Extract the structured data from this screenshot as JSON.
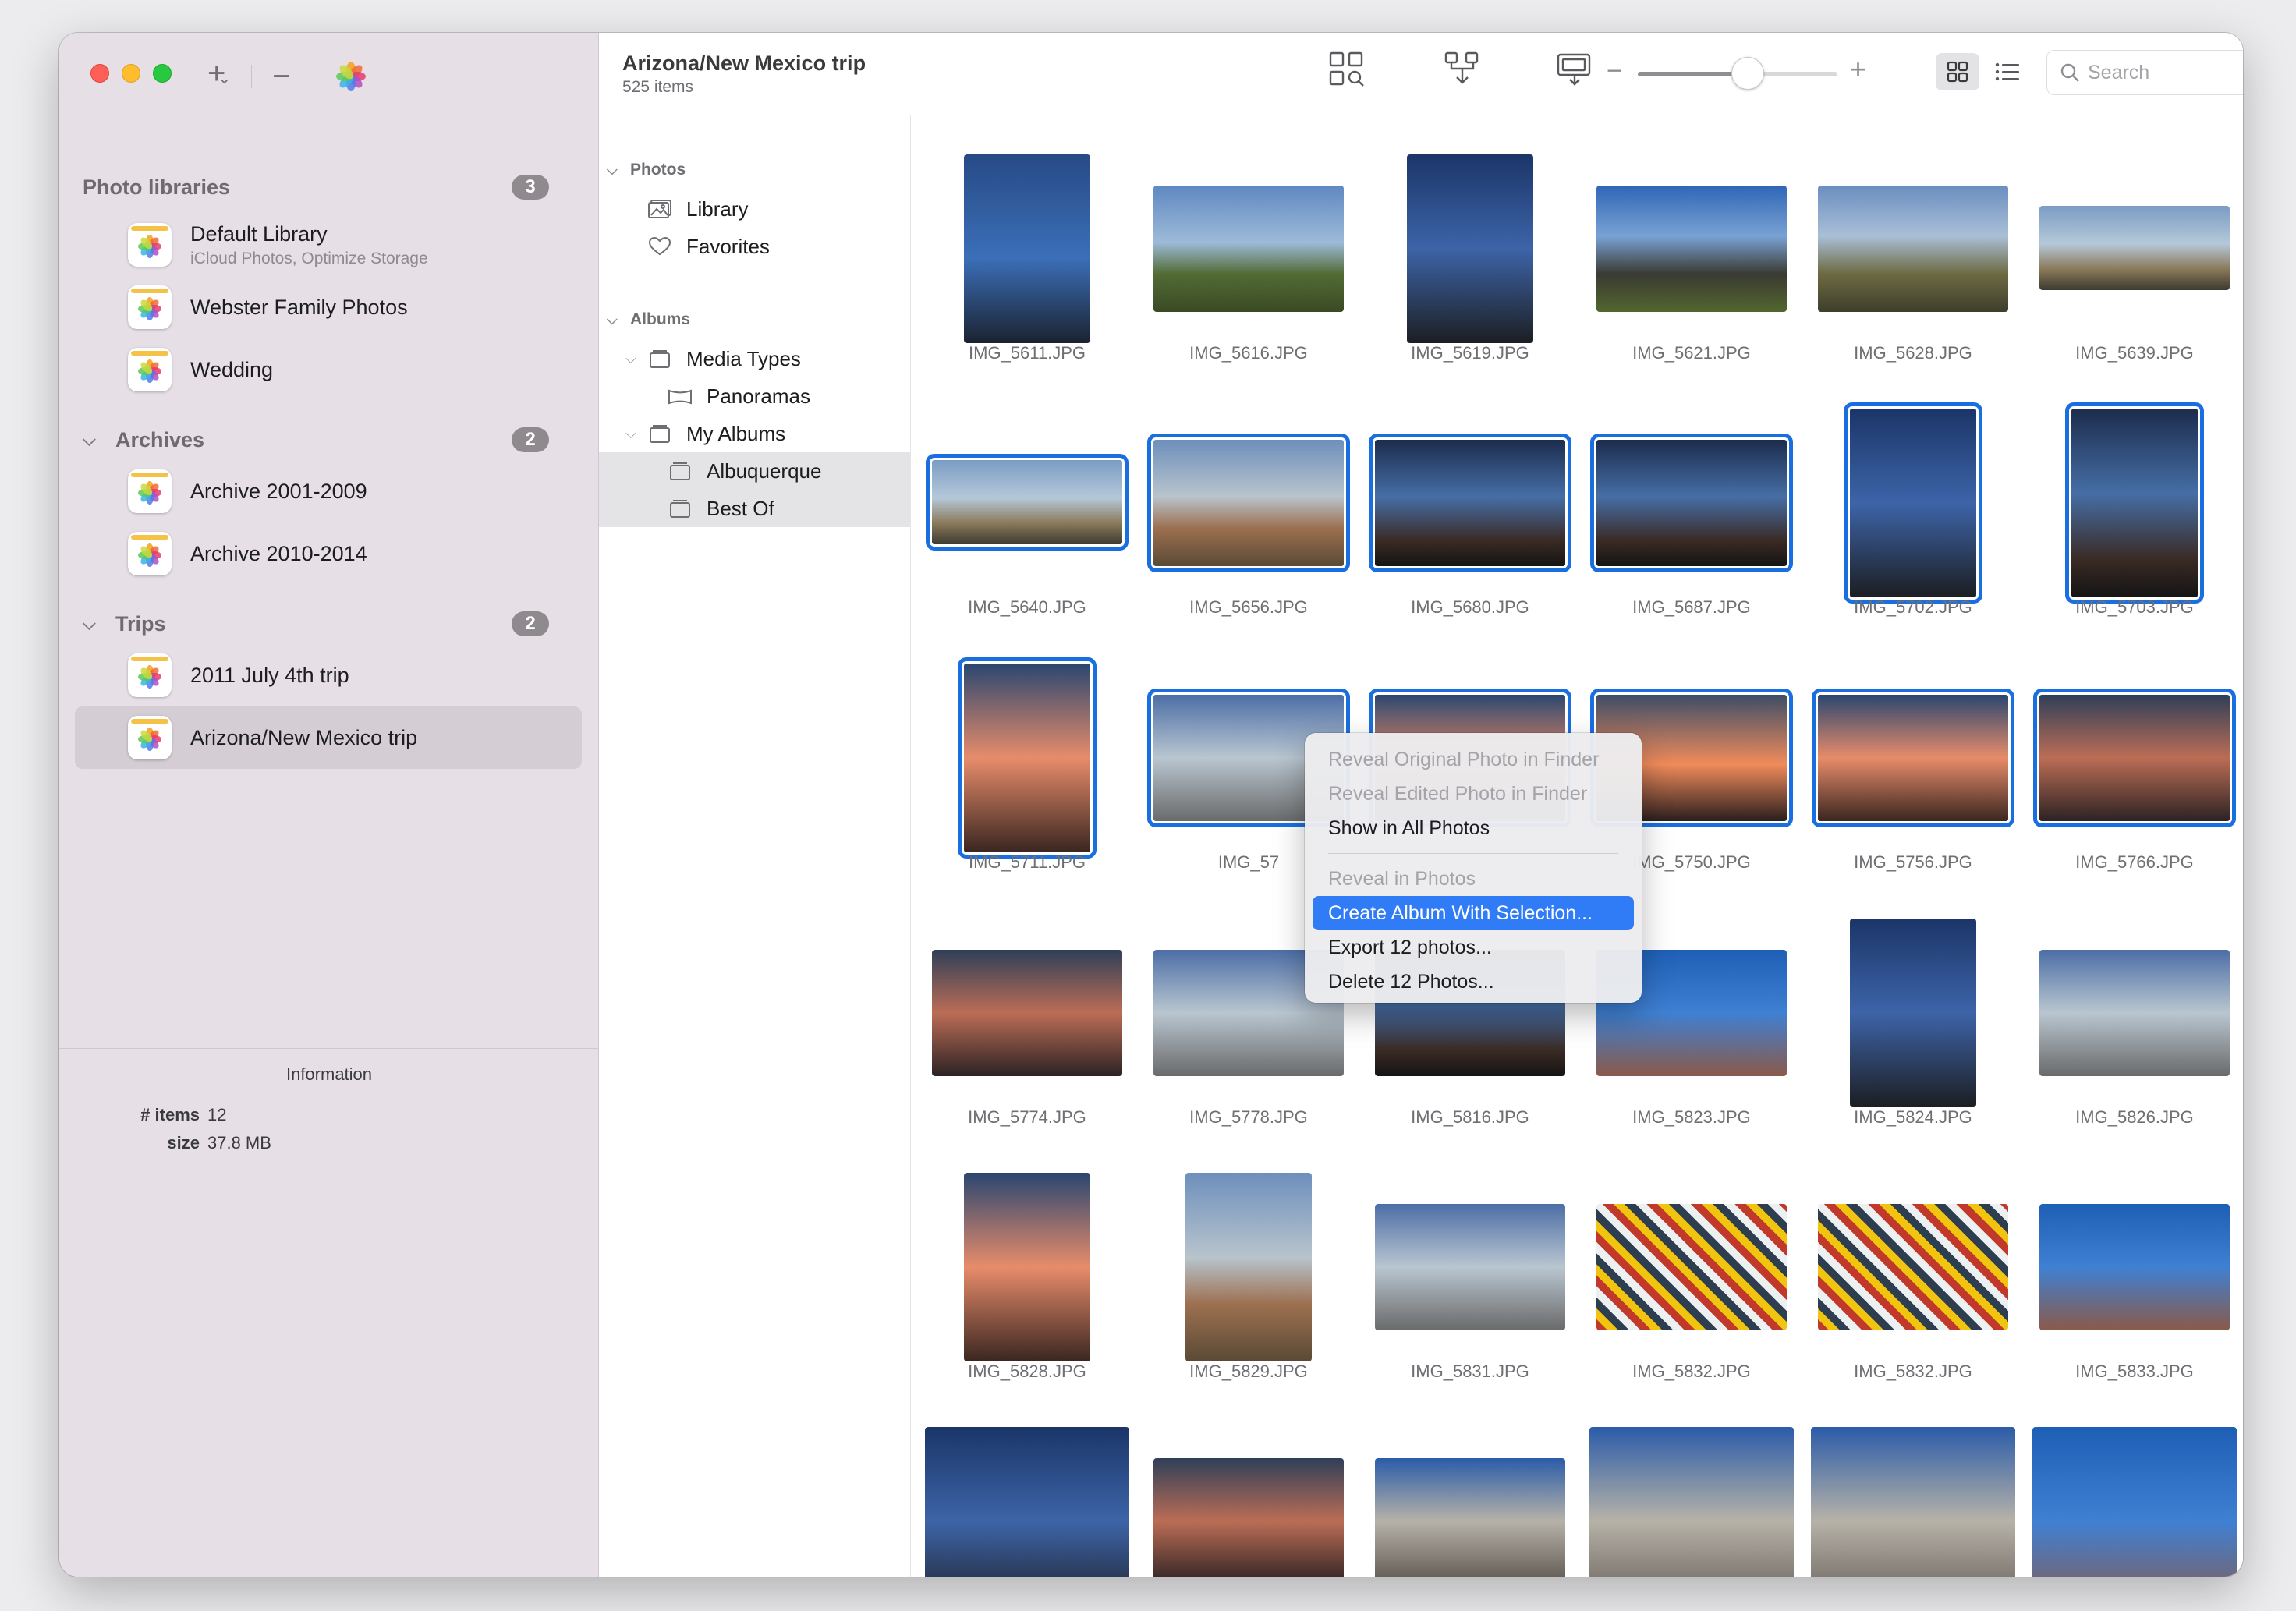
{
  "sidebar": {
    "groups": [
      {
        "title": "Photo libraries",
        "count": "3",
        "items": [
          {
            "name": "Default Library",
            "sub": "iCloud Photos, Optimize Storage"
          },
          {
            "name": "Webster Family Photos"
          },
          {
            "name": "Wedding"
          }
        ]
      },
      {
        "title": "Archives",
        "count": "2",
        "items": [
          {
            "name": "Archive 2001-2009"
          },
          {
            "name": "Archive 2010-2014"
          }
        ]
      },
      {
        "title": "Trips",
        "count": "2",
        "items": [
          {
            "name": "2011 July 4th trip"
          },
          {
            "name": "Arizona/New Mexico trip"
          }
        ]
      }
    ]
  },
  "info": {
    "title": "Information",
    "items_label": "# items",
    "items_value": "12",
    "size_label": "size",
    "size_value": "37.8 MB"
  },
  "header": {
    "title": "Arizona/New Mexico trip",
    "subtitle": "525 items",
    "zoom_level": 0.55,
    "search_placeholder": "Search"
  },
  "tree": {
    "photos_header": "Photos",
    "library": "Library",
    "favorites": "Favorites",
    "albums_header": "Albums",
    "media_types": "Media Types",
    "panoramas": "Panoramas",
    "my_albums": "My Albums",
    "albuquerque": "Albuquerque",
    "best_of": "Best Of"
  },
  "photos": [
    {
      "name": "IMG_5611.JPG",
      "selected": false,
      "orient": "portrait"
    },
    {
      "name": "IMG_5616.JPG",
      "selected": false,
      "orient": "landscape"
    },
    {
      "name": "IMG_5619.JPG",
      "selected": false,
      "orient": "portrait"
    },
    {
      "name": "IMG_5621.JPG",
      "selected": false,
      "orient": "landscape"
    },
    {
      "name": "IMG_5628.JPG",
      "selected": false,
      "orient": "landscape"
    },
    {
      "name": "IMG_5639.JPG",
      "selected": false,
      "orient": "wide"
    },
    {
      "name": "IMG_5640.JPG",
      "selected": true,
      "orient": "wide"
    },
    {
      "name": "IMG_5656.JPG",
      "selected": true,
      "orient": "landscape"
    },
    {
      "name": "IMG_5680.JPG",
      "selected": true,
      "orient": "landscape"
    },
    {
      "name": "IMG_5687.JPG",
      "selected": true,
      "orient": "landscape"
    },
    {
      "name": "IMG_5702.JPG",
      "selected": true,
      "orient": "portrait"
    },
    {
      "name": "IMG_5703.JPG",
      "selected": true,
      "orient": "portrait"
    },
    {
      "name": "IMG_5711.JPG",
      "selected": true,
      "orient": "portrait"
    },
    {
      "name": "IMG_57",
      "selected": true,
      "orient": "landscape"
    },
    {
      "name": "",
      "selected": true,
      "orient": "landscape"
    },
    {
      "name": "IMG_5750.JPG",
      "selected": true,
      "orient": "landscape"
    },
    {
      "name": "IMG_5756.JPG",
      "selected": true,
      "orient": "landscape"
    },
    {
      "name": "IMG_5766.JPG",
      "selected": true,
      "orient": "landscape"
    },
    {
      "name": "IMG_5774.JPG",
      "selected": false,
      "orient": "landscape"
    },
    {
      "name": "IMG_5778.JPG",
      "selected": false,
      "orient": "landscape"
    },
    {
      "name": "IMG_5816.JPG",
      "selected": false,
      "orient": "landscape"
    },
    {
      "name": "IMG_5823.JPG",
      "selected": false,
      "orient": "landscape"
    },
    {
      "name": "IMG_5824.JPG",
      "selected": false,
      "orient": "portrait"
    },
    {
      "name": "IMG_5826.JPG",
      "selected": false,
      "orient": "landscape"
    },
    {
      "name": "IMG_5828.JPG",
      "selected": false,
      "orient": "portrait"
    },
    {
      "name": "IMG_5829.JPG",
      "selected": false,
      "orient": "portrait"
    },
    {
      "name": "IMG_5831.JPG",
      "selected": false,
      "orient": "landscape"
    },
    {
      "name": "IMG_5832.JPG",
      "selected": false,
      "orient": "landscape"
    },
    {
      "name": "IMG_5832.JPG",
      "selected": false,
      "orient": "landscape"
    },
    {
      "name": "IMG_5833.JPG",
      "selected": false,
      "orient": "landscape"
    },
    {
      "name": "",
      "selected": false,
      "orient": "tall"
    },
    {
      "name": "",
      "selected": false,
      "orient": "landscape"
    },
    {
      "name": "",
      "selected": false,
      "orient": "landscape"
    },
    {
      "name": "",
      "selected": false,
      "orient": "tall"
    },
    {
      "name": "",
      "selected": false,
      "orient": "tall"
    },
    {
      "name": "",
      "selected": false,
      "orient": "tall"
    }
  ],
  "context_menu": {
    "items": [
      {
        "label": "Reveal Original Photo in Finder",
        "state": "disabled"
      },
      {
        "label": "Reveal Edited Photo in Finder",
        "state": "disabled"
      },
      {
        "label": "Show in All Photos",
        "state": "enabled"
      },
      {
        "label": "",
        "state": "separator"
      },
      {
        "label": "Reveal in Photos",
        "state": "disabled"
      },
      {
        "label": "Create Album With Selection...",
        "state": "highlight"
      },
      {
        "label": "Export 12 photos...",
        "state": "enabled"
      },
      {
        "label": "Delete 12 Photos...",
        "state": "enabled"
      }
    ]
  },
  "colors": {
    "selection": "#1a6fe0",
    "menu_highlight": "#2f7cf6",
    "sidebar_bg": "#e6dfe6"
  }
}
